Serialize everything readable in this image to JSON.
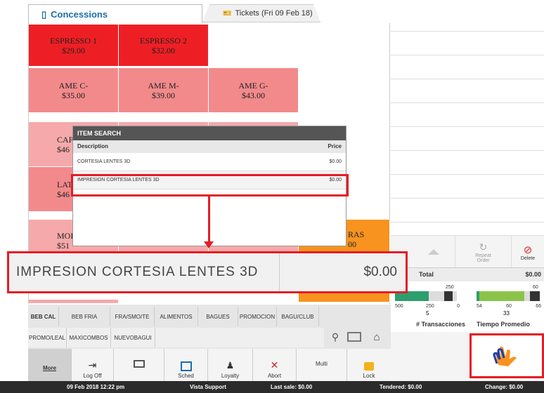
{
  "tabs": {
    "active": "Concessions",
    "inactive": "Tickets (Fri 09 Feb 18)"
  },
  "products": [
    {
      "name": "ESPRESSO 1",
      "price": "$29.00"
    },
    {
      "name": "ESPRESSO 2",
      "price": "$32.00"
    },
    {
      "name": "AME C-",
      "price": "$35.00"
    },
    {
      "name": "AME M-",
      "price": "$39.00"
    },
    {
      "name": "AME G-",
      "price": "$43.00"
    },
    {
      "name": "CAP",
      "price": "$46"
    },
    {
      "name": "LAT",
      "price": "$46"
    },
    {
      "name": "MOK",
      "price": "$51"
    },
    {
      "name": "RAS",
      "price": "00"
    }
  ],
  "item_search": {
    "title": "ITEM SEARCH",
    "col_description": "Description",
    "col_price": "Price",
    "rows": [
      {
        "description": "CORTESIA LENTES 3D",
        "price": "$0.00"
      },
      {
        "description": "IMPRESION CORTESIA LENTES 3D",
        "price": "$0.00"
      }
    ]
  },
  "callout": {
    "description": "IMPRESION CORTESIA LENTES 3D",
    "price": "$0.00"
  },
  "order_actions": {
    "repeat": "Repeat Order",
    "delete": "Delete"
  },
  "total": {
    "label": "Total",
    "value": "$0.00"
  },
  "stats": {
    "transactions": {
      "label": "# Transacciones",
      "value": "5",
      "scale": [
        "500",
        "250",
        "0"
      ],
      "target": "250"
    },
    "avg_time": {
      "label": "Tiempo Promedio",
      "value": "33",
      "scale": [
        "54",
        "60",
        "66"
      ],
      "target": "60"
    }
  },
  "categories_row1": [
    "BEB CAL",
    "BEB FRIA",
    "FRA/SMO/TE",
    "ALIMENTOS",
    "BAGUES",
    "PROMOCION",
    "BAGU/CLUB"
  ],
  "categories_row2": [
    "PROMO/LEAL",
    "MAXICOMBOS",
    "NUEVOBAGUI"
  ],
  "toolbar": [
    "More",
    "Log Off",
    "",
    "Sched",
    "Loyalty",
    "Abort",
    "Multi",
    "Lock"
  ],
  "status": {
    "datetime": "09 Feb 2018 12:22 pm",
    "user": "Vista Support",
    "last_sale": "Last sale: $0.00",
    "tendered": "Tendered: $0.00",
    "change": "Change: $0.00"
  },
  "colors": {
    "accent": "#1a6fa8",
    "highlight": "#e41d24",
    "red_btn": "#ee1f24",
    "pink_btn": "#f28a8c",
    "orange_btn": "#f7931e"
  }
}
